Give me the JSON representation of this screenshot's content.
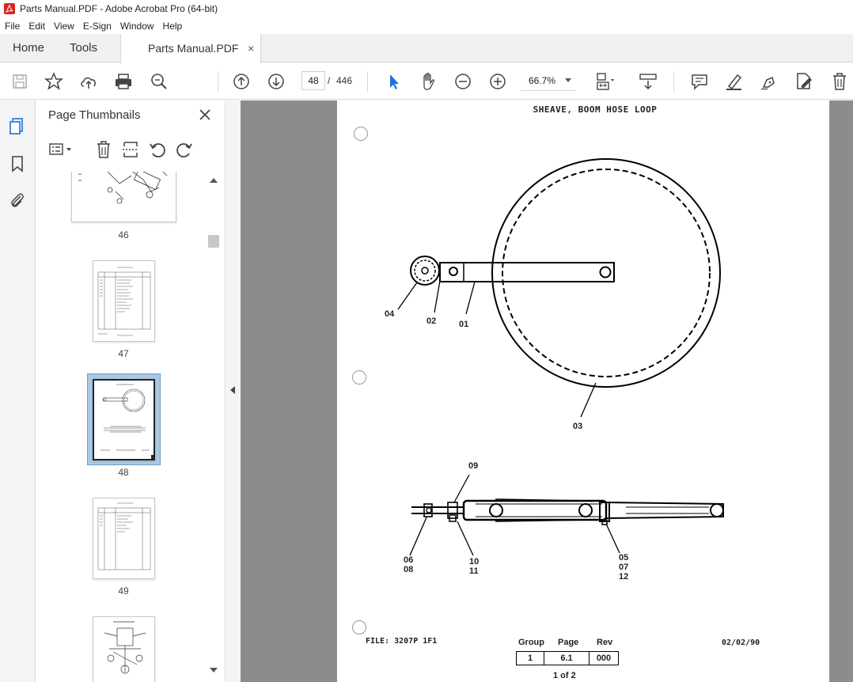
{
  "window": {
    "title": "Parts Manual.PDF - Adobe Acrobat Pro (64-bit)"
  },
  "menu": [
    "File",
    "Edit",
    "View",
    "E-Sign",
    "Window",
    "Help"
  ],
  "nav_tabs": {
    "home": "Home",
    "tools": "Tools"
  },
  "doc_tab": {
    "label": "Parts Manual.PDF",
    "close": "×"
  },
  "toolbar": {
    "current_page": "48",
    "separator": "/",
    "total_pages": "446",
    "zoom": "66.7%"
  },
  "thumbnails_panel": {
    "title": "Page Thumbnails",
    "pages": [
      "46",
      "47",
      "48",
      "49"
    ],
    "selected_page": "48"
  },
  "document": {
    "title": "SHEAVE, BOOM HOSE LOOP",
    "callouts_top": [
      "04",
      "02",
      "01",
      "03"
    ],
    "callouts_bottom": {
      "a": "09",
      "b": "06",
      "c": "08",
      "d": "10",
      "e": "11",
      "f": "05",
      "g": "07",
      "h": "12"
    },
    "file_label": "FILE: 3207P 1F1",
    "headers": {
      "group": "Group",
      "page": "Page",
      "rev": "Rev"
    },
    "values": {
      "group": "1",
      "page": "6.1",
      "rev": "000"
    },
    "page_of": "1 of 2",
    "date": "02/02/90"
  },
  "colors": {
    "accent_blue": "#1a73d9",
    "doc_bg": "#8c8c8c"
  }
}
